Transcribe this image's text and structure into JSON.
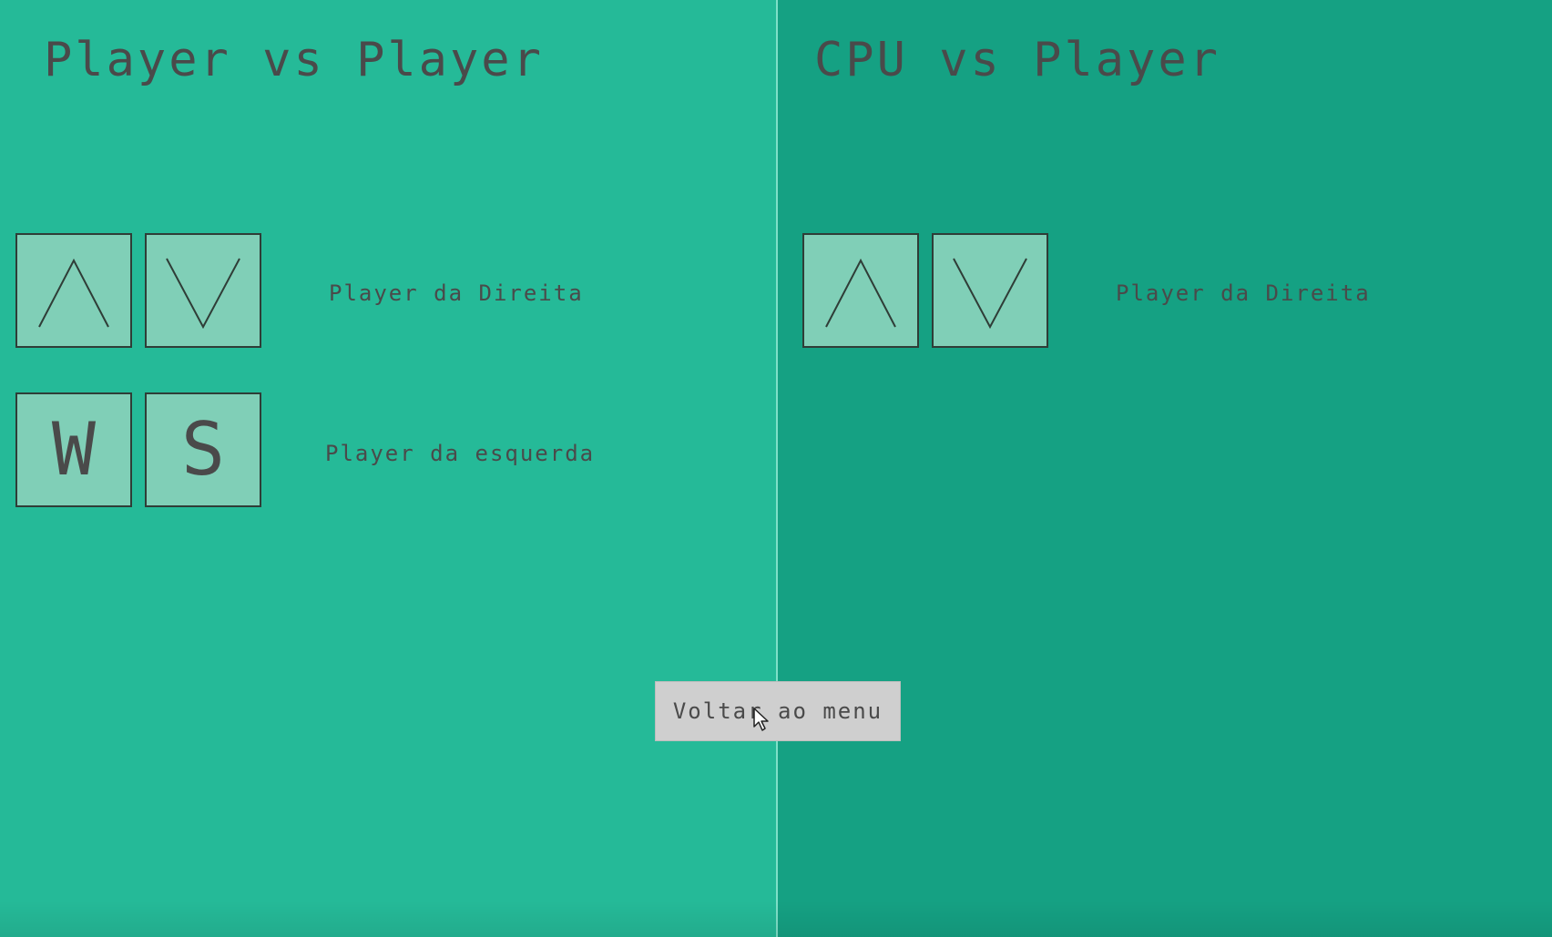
{
  "colors": {
    "left_panel_bg": "#25ba98",
    "right_panel_bg": "#15a183",
    "key_bg": "#80cfb7",
    "text": "#4a4a4a",
    "button_bg": "#cfcfcf"
  },
  "pvp": {
    "title": "Player vs Player",
    "controls": [
      {
        "keys": [
          "arrow-up-icon",
          "arrow-down-icon"
        ],
        "label": "Player da Direita"
      },
      {
        "keys": [
          "W",
          "S"
        ],
        "label": "Player da esquerda"
      }
    ]
  },
  "cpu": {
    "title": "CPU vs Player",
    "controls": [
      {
        "keys": [
          "arrow-up-icon",
          "arrow-down-icon"
        ],
        "label": "Player da Direita"
      }
    ]
  },
  "back_button": {
    "label": "Voltar ao menu"
  },
  "cursor": {
    "icon": "mouse-pointer-icon"
  }
}
